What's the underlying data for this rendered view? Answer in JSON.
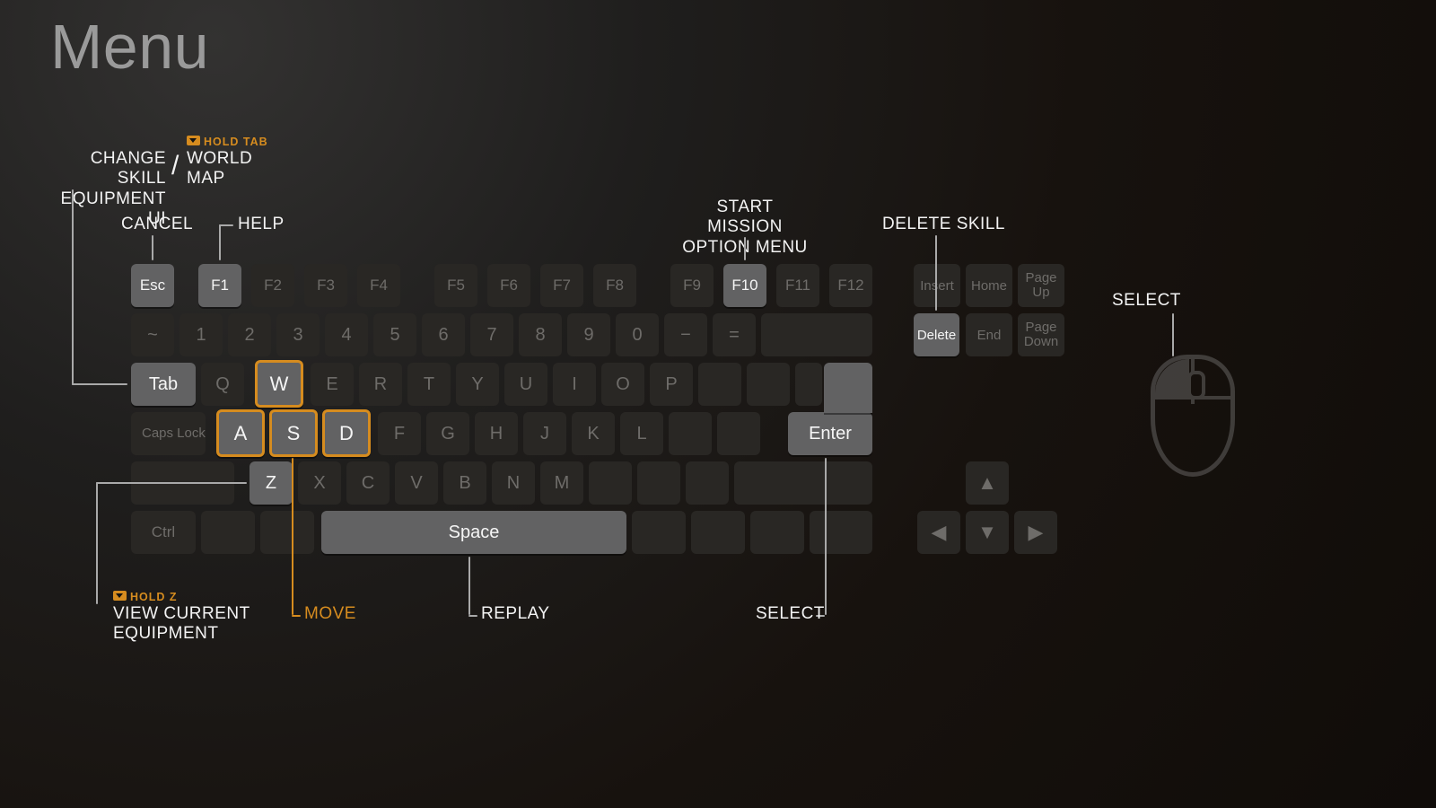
{
  "title": "Menu",
  "colors": {
    "amber": "#d68c1f"
  },
  "labels": {
    "tab_left_l1": "CHANGE SKILL",
    "tab_left_l2": "EQUIPMENT UI",
    "tab_hold": "HOLD TAB",
    "tab_right_l1": "WORLD",
    "tab_right_l2": "MAP",
    "cancel": "CANCEL",
    "help": "HELP",
    "start_l1": "START MISSION",
    "start_l2": "OPTION MENU",
    "delete_skill": "DELETE SKILL",
    "mouse_select": "SELECT",
    "z_hold": "HOLD Z",
    "z_l1": "VIEW CURRENT",
    "z_l2": "EQUIPMENT",
    "move": "MOVE",
    "replay": "REPLAY",
    "enter_select": "SELECT"
  },
  "highlighted_keys": [
    "Esc",
    "F1",
    "F10",
    "Delete",
    "Tab",
    "W",
    "A",
    "S",
    "D",
    "Z",
    "Space",
    "Enter"
  ],
  "amber_keys": [
    "W",
    "A",
    "S",
    "D"
  ],
  "keys": {
    "esc": "Esc",
    "f1": "F1",
    "f2": "F2",
    "f3": "F3",
    "f4": "F4",
    "f5": "F5",
    "f6": "F6",
    "f7": "F7",
    "f8": "F8",
    "f9": "F9",
    "f10": "F10",
    "f11": "F11",
    "f12": "F12",
    "ins": "Insert",
    "home": "Home",
    "pgup": "Page Up",
    "del": "Delete",
    "end": "End",
    "pgdn": "Page Down",
    "tilde": "~",
    "n1": "1",
    "n2": "2",
    "n3": "3",
    "n4": "4",
    "n5": "5",
    "n6": "6",
    "n7": "7",
    "n8": "8",
    "n9": "9",
    "n0": "0",
    "minus": "−",
    "equals": "=",
    "tab": "Tab",
    "q": "Q",
    "w": "W",
    "e": "E",
    "r": "R",
    "t": "T",
    "y": "Y",
    "u": "U",
    "i": "I",
    "o": "O",
    "p": "P",
    "caps": "Caps Lock",
    "a": "A",
    "s": "S",
    "d": "D",
    "f": "F",
    "g": "G",
    "h": "H",
    "j": "J",
    "k": "K",
    "l": "L",
    "enter": "Enter",
    "z": "Z",
    "x": "X",
    "c": "C",
    "v": "V",
    "b": "B",
    "n": "N",
    "m": "M",
    "ctrl": "Ctrl",
    "space": "Space"
  },
  "arrows": {
    "up": "▲",
    "left": "◀",
    "down": "▼",
    "right": "▶"
  }
}
